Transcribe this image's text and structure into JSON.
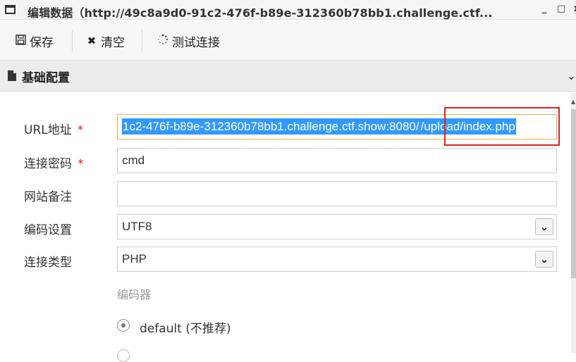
{
  "window": {
    "title": "编辑数据（http://49c8a9d0-91c2-476f-b89e-312360b78bb1.challenge.ctf...",
    "minimize": "_",
    "maximize": "□",
    "close": "x"
  },
  "toolbar": {
    "save_icon": "save-icon",
    "save_label": "保存",
    "clear_icon": "x-icon",
    "clear_label": "清空",
    "test_icon": "spinner-icon",
    "test_label": "测试连接"
  },
  "section": {
    "title": "基础配置",
    "chevron": "⌄"
  },
  "form": {
    "url": {
      "label": "URL地址",
      "required_mark": "*",
      "value_prefix": "1c2-476f-b89e-312360b78bb1.challenge.ctf.show:8080/",
      "value_highlighted": "/upload/index.php"
    },
    "password": {
      "label": "连接密码",
      "required_mark": "*",
      "value": "cmd"
    },
    "note": {
      "label": "网站备注",
      "value": ""
    },
    "encoding": {
      "label": "编码设置",
      "value": "UTF8"
    },
    "type": {
      "label": "连接类型",
      "value": "PHP"
    },
    "encoder": {
      "label": "编码器",
      "option_default": "default (不推荐)"
    }
  },
  "colors": {
    "selection": "#3399ff",
    "required": "#e02020",
    "annotation_box": "#e02020",
    "active_border": "#e8b04a"
  }
}
